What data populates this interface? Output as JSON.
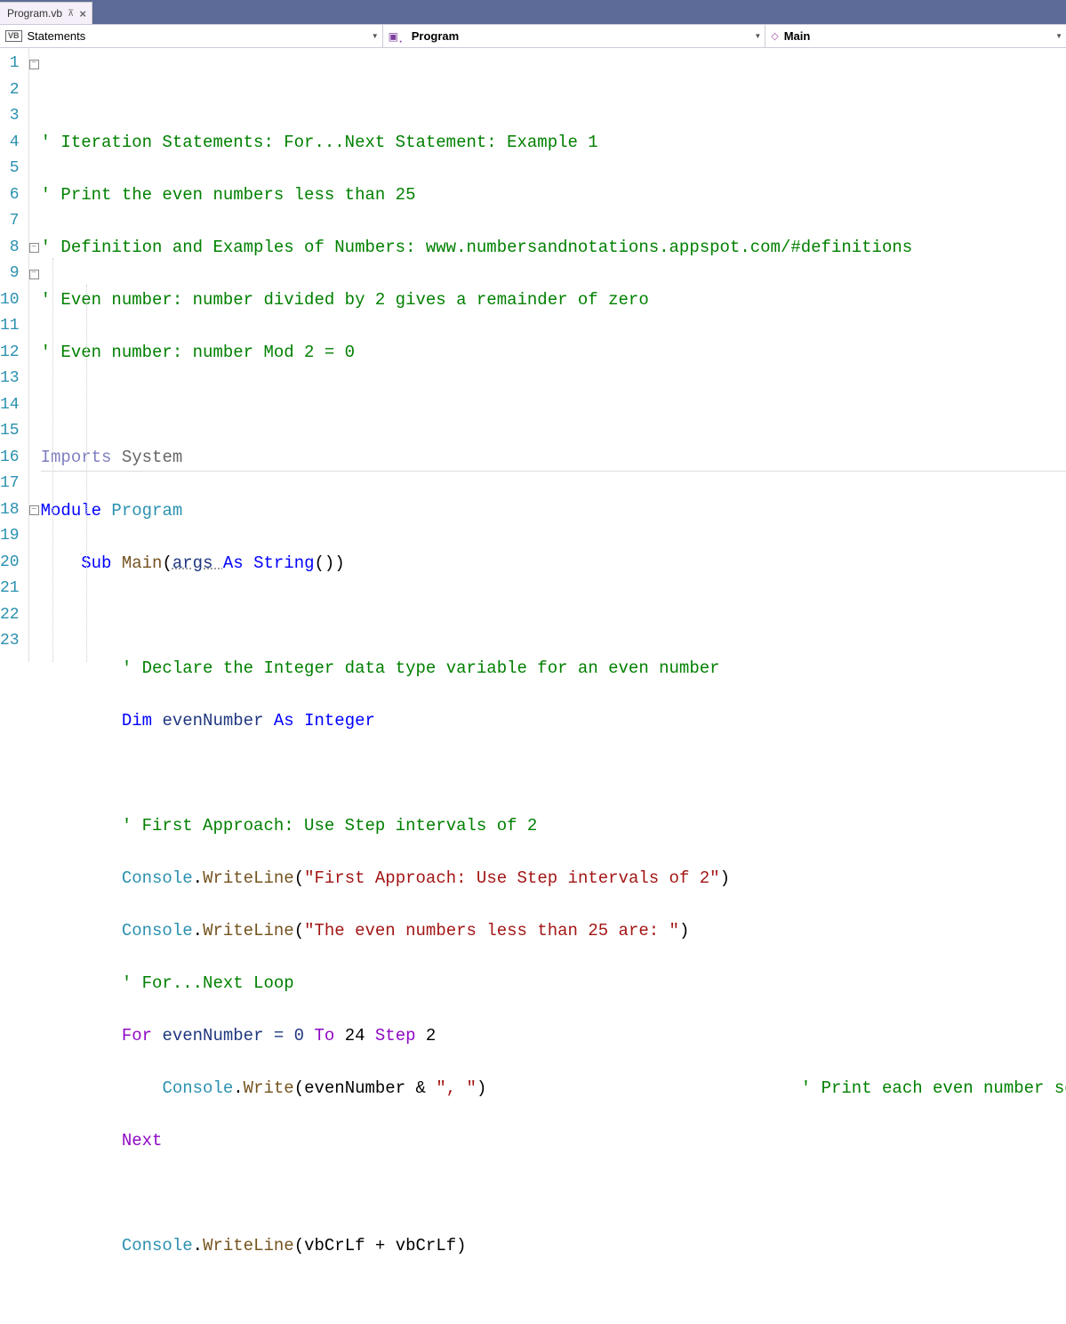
{
  "tab": {
    "filename": "Program.vb"
  },
  "nav": {
    "scope": "Statements",
    "module": "Program",
    "method": "Main"
  },
  "lines": {
    "count": 23,
    "l1": "' Iteration Statements: For...Next Statement: Example 1",
    "l2": "' Print the even numbers less than 25",
    "l3": "' Definition and Examples of Numbers: www.numbersandnotations.appspot.com/#definitions",
    "l4": "' Even number: number divided by 2 gives a remainder of zero",
    "l5": "' Even number: number Mod 2 = 0",
    "l7_imports": "Imports",
    "l7_system": " System",
    "l8_module": "Module",
    "l8_program": " Program",
    "l9_sub": "Sub",
    "l9_main": " Main",
    "l9_args": "args ",
    "l9_as": "As",
    "l9_string": " String",
    "l11": "' Declare the Integer data type variable for an even number",
    "l12_dim": "Dim",
    "l12_var": " evenNumber ",
    "l12_as": "As",
    "l12_int": " Integer",
    "l14": "' First Approach: Use Step intervals of 2",
    "l15_console": "Console",
    "l15_write": "WriteLine",
    "l15_str": "\"First Approach: Use Step intervals of 2\"",
    "l16_str": "\"The even numbers less than 25 are: \"",
    "l17": "' For...Next Loop",
    "l18_for": "For",
    "l18_var": " evenNumber = 0 ",
    "l18_to": "To",
    "l18_24": " 24 ",
    "l18_step": "Step",
    "l18_2": " 2",
    "l19_console": "Console",
    "l19_write": "Write",
    "l19_arg": "(evenNumber & ",
    "l19_str": "\", \"",
    "l19_comment": "' Print each even number separated with a comma",
    "l20_next": "Next",
    "l22_console": "Console",
    "l22_write": "WriteLine",
    "l22_arg": "(vbCrLf + vbCrLf)"
  }
}
